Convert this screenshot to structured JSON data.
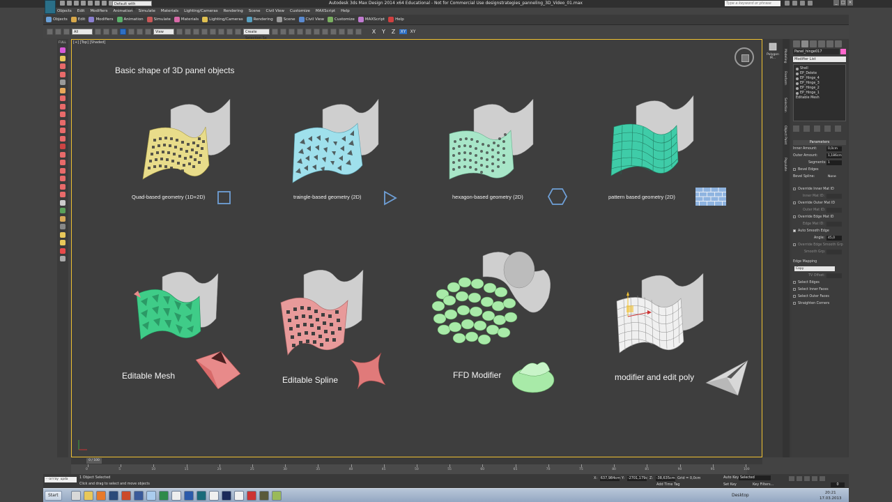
{
  "window": {
    "title": "Autodesk 3ds Max Design 2014 x64    Educational - Not for Commercial Use    designstrategies_panneling_3D_Video_01.max",
    "workspace": "Default with Enhanced M",
    "search_placeholder": "Type a keyword or phrase"
  },
  "menu": [
    "Objects",
    "Edit",
    "Modifiers",
    "Animation",
    "Simulate",
    "Materials",
    "Lighting/Cameras",
    "Rendering",
    "Scene",
    "Civil View",
    "Customize",
    "MAXScript",
    "Help"
  ],
  "ribbon": [
    {
      "label": "Objects",
      "color": "#6aa0d8"
    },
    {
      "label": "Edit",
      "color": "#d8a84a"
    },
    {
      "label": "Modifiers",
      "color": "#8a7fd0"
    },
    {
      "label": "Animation",
      "color": "#5ab06a"
    },
    {
      "label": "Simulate",
      "color": "#c85858"
    },
    {
      "label": "Materials",
      "color": "#d86aa8"
    },
    {
      "label": "Lighting/Cameras",
      "color": "#e0c050"
    },
    {
      "label": "Rendering",
      "color": "#58a0c0"
    },
    {
      "label": "Scene",
      "color": "#9a9a9a"
    },
    {
      "label": "Civil View",
      "color": "#5a8ad0"
    },
    {
      "label": "Customize",
      "color": "#7ab060"
    },
    {
      "label": "MAXScript",
      "color": "#c07ad0"
    },
    {
      "label": "Help",
      "color": "#d04040"
    }
  ],
  "toolbar": {
    "filter": "All",
    "ref_coord": "View",
    "selection_set": "Create Selection Se",
    "axes": [
      "X",
      "Y",
      "Z",
      "XY",
      "XY"
    ]
  },
  "leftstrip": {
    "label": "FULL"
  },
  "viewport": {
    "label": "[+] [Top] [Shaded]",
    "title": "Basic shape of 3D panel objects",
    "row1": [
      {
        "label": "Quad-based geometry (1D+2D)",
        "color": "#e8dc8a",
        "icon": "square-icon"
      },
      {
        "label": "traingle-based geometry (2D)",
        "color": "#9fe0ec",
        "icon": "triangle-icon"
      },
      {
        "label": "hexagon-based geometry (2D)",
        "color": "#a8e6c8",
        "icon": "hexagon-icon"
      },
      {
        "label": "pattern based geometry (2D)",
        "color": "#3fcca8",
        "icon": "brick-pattern-icon"
      }
    ],
    "row2": [
      {
        "label": "Editable Mesh",
        "color": "#3fcc88"
      },
      {
        "label": "Editable Spline",
        "color": "#e89a9a"
      },
      {
        "label": "FFD Modifier",
        "color": "#a8eaa8"
      },
      {
        "label": "modifier and edit poly",
        "color": "#e8e8e8"
      }
    ]
  },
  "rightpanel": {
    "caption": "Polygon M...",
    "vtabs": [
      "Modeling",
      "Freeform",
      "Selection",
      "Object Paint",
      "Populate"
    ],
    "object_name": "Panel_hinge017",
    "modifier_list": "Modifier List",
    "stack": [
      "Shell",
      "EP_Delete",
      "EP_Hinge_4",
      "EP_Hinge_3",
      "EP_Hinge_2",
      "EP_Hinge_1",
      "Editable Mesh"
    ],
    "params_title": "Parameters",
    "inner_amount_label": "Inner Amount:",
    "inner_amount": "0,0cm",
    "outer_amount_label": "Outer Amount:",
    "outer_amount": "1,186cm",
    "segments_label": "Segments:",
    "segments": "1",
    "bevel_edges": "Bevel Edges",
    "bevel_spline_label": "Bevel Spline:",
    "bevel_spline": "None",
    "override_inner": "Override Inner Mat ID",
    "inner_mat": "Inner Mat ID:",
    "override_outer": "Override Outer Mat ID",
    "outer_mat": "Outer Mat ID:",
    "override_edge": "Override Edge Mat ID",
    "edge_mat": "Edge Mat ID:",
    "auto_smooth": "Auto Smooth Edge",
    "angle_label": "Angle:",
    "angle": "45,0",
    "override_smooth": "Override Edge Smooth Grp",
    "smooth_grp": "Smooth Grp:",
    "edge_mapping": "Edge Mapping",
    "edge_mapping_val": "Copy",
    "tv_offset": "TV Offset:",
    "select_edges": "Select Edges",
    "select_inner": "Select Inner Faces",
    "select_outer": "Select Outer Faces",
    "straighten": "Straighten Corners"
  },
  "timeline": {
    "thumb": "0 / 100",
    "ticks": [
      "0",
      "5",
      "10",
      "15",
      "20",
      "25",
      "30",
      "35",
      "40",
      "45",
      "50",
      "55",
      "60",
      "65",
      "70",
      "75",
      "80",
      "85",
      "90",
      "95",
      "100"
    ]
  },
  "status": {
    "listener": "--array upda",
    "selected": "1 Object Selected",
    "prompt": "Click and drag to select and move objects",
    "x": "637,984cm",
    "y": "-2701,179c",
    "z": "-38,635cm",
    "grid": "Grid = 0,0cm",
    "auto_key": "Auto Key",
    "selected_dd": "Selected",
    "set_key": "Set Key",
    "key_filters": "Key Filters...",
    "add_time_tag": "Add Time Tag",
    "frame": "0"
  },
  "taskbar": {
    "start": "Start",
    "desktop": "Desktop",
    "time": "20:21",
    "date": "17.03.2013"
  }
}
